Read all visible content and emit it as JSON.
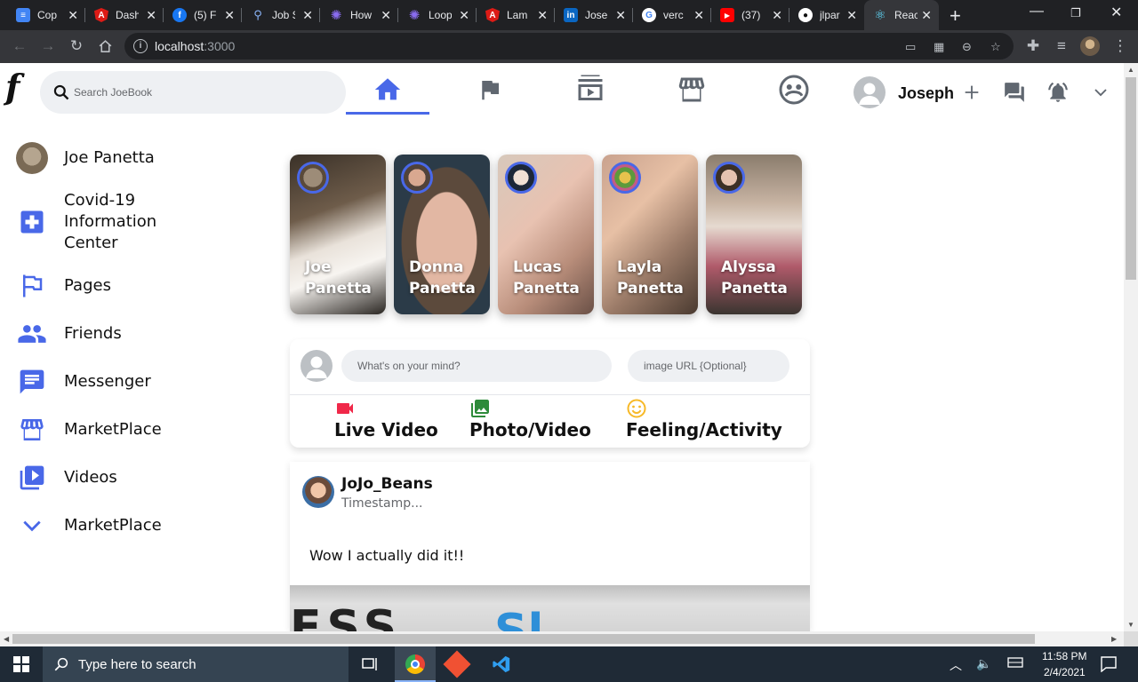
{
  "browser": {
    "tabs": [
      {
        "label": "Cop",
        "icon": "google-docs-icon",
        "color": "#4285f4"
      },
      {
        "label": "Dash",
        "icon": "angular-icon",
        "color": "#dd1b16"
      },
      {
        "label": "(5) F",
        "icon": "facebook-icon",
        "color": "#1877f2"
      },
      {
        "label": "Job S",
        "icon": "magnifier-icon",
        "color": "#5f6368"
      },
      {
        "label": "How",
        "icon": "gear-icon",
        "color": "#6a3fd8"
      },
      {
        "label": "Loop",
        "icon": "gear-icon",
        "color": "#6a3fd8"
      },
      {
        "label": "Lam",
        "icon": "angular-icon",
        "color": "#dd1b16"
      },
      {
        "label": "Jose",
        "icon": "linkedin-icon",
        "color": "#0a66c2"
      },
      {
        "label": "verc",
        "icon": "google-icon",
        "color": "#ffffff"
      },
      {
        "label": "(37)",
        "icon": "youtube-icon",
        "color": "#ff0000"
      },
      {
        "label": "jlpar",
        "icon": "github-icon",
        "color": "#ffffff"
      },
      {
        "label": "Reac",
        "icon": "react-icon",
        "color": "#61dafb"
      }
    ],
    "active_tab": 11,
    "url": {
      "host": "localhost",
      "port": ":3000"
    }
  },
  "header": {
    "logo": "f",
    "search_placeholder": "Search JoeBook",
    "nav_tabs": [
      {
        "name": "home",
        "icon": "home-icon"
      },
      {
        "name": "pages",
        "icon": "flag-icon"
      },
      {
        "name": "watch",
        "icon": "video-library-icon"
      },
      {
        "name": "marketplace",
        "icon": "storefront-icon"
      },
      {
        "name": "groups",
        "icon": "supervised-account-icon"
      }
    ],
    "user_name": "Joseph"
  },
  "sidebar": {
    "items": [
      {
        "label": "Joe Panetta",
        "icon": "user-avatar"
      },
      {
        "label": "Covid-19 Information Center",
        "icon": "local-hospital-icon"
      },
      {
        "label": "Pages",
        "icon": "emoji-flags-icon"
      },
      {
        "label": "Friends",
        "icon": "people-icon"
      },
      {
        "label": "Messenger",
        "icon": "chat-icon"
      },
      {
        "label": "MarketPlace",
        "icon": "storefront-icon"
      },
      {
        "label": "Videos",
        "icon": "video-library-icon"
      },
      {
        "label": "MarketPlace",
        "icon": "expand-more-icon"
      }
    ]
  },
  "stories": [
    {
      "first": "Joe",
      "last": "Panetta"
    },
    {
      "first": "Donna",
      "last": "Panetta"
    },
    {
      "first": "Lucas",
      "last": "Panetta"
    },
    {
      "first": "Layla",
      "last": "Panetta"
    },
    {
      "first": "Alyssa",
      "last": "Panetta"
    }
  ],
  "composer": {
    "message_placeholder": "What's on your mind?",
    "image_placeholder": "image URL {Optional}",
    "options": [
      {
        "label": "Live Video",
        "icon": "videocam-icon",
        "color": "#f02849"
      },
      {
        "label": "Photo/Video",
        "icon": "photo-library-icon",
        "color": "#2e8b3a"
      },
      {
        "label": "Feeling/Activity",
        "icon": "emoji-icon",
        "color": "#f7b928"
      }
    ]
  },
  "post": {
    "username": "JoJo_Beans",
    "timestamp": "Timestamp...",
    "message": "Wow I actually did it!!"
  },
  "taskbar": {
    "search_label": "Type here to search",
    "time": "11:58 PM",
    "date": "2/4/2021"
  },
  "colors": {
    "accent": "#4968e8",
    "page_bg": "#ffffff"
  }
}
